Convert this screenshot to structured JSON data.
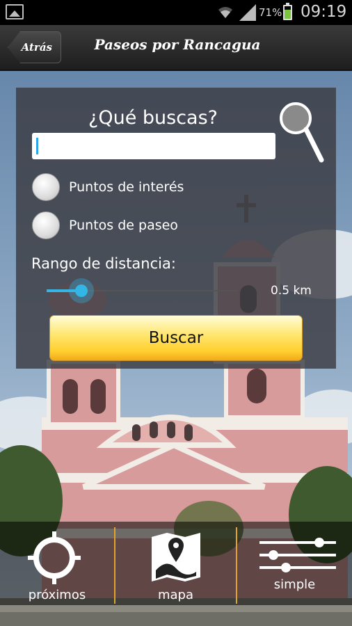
{
  "status_bar": {
    "battery_percent": "71%",
    "battery_level": 0.71,
    "time": "09:19",
    "icons": [
      "gallery-icon",
      "wifi-icon",
      "signal-icon",
      "battery-icon"
    ]
  },
  "action_bar": {
    "back_label": "Atrás",
    "title": "Paseos por Rancagua"
  },
  "search_panel": {
    "heading": "¿Qué buscas?",
    "search_value": "",
    "options": [
      {
        "label": "Puntos de interés",
        "selected": false
      },
      {
        "label": "Puntos de paseo",
        "selected": false
      }
    ],
    "range_label": "Rango de distancia:",
    "range_value_text": "0.5 km",
    "range_fraction": 0.18,
    "search_button_label": "Buscar"
  },
  "tab_bar": {
    "tabs": [
      {
        "label": "próximos",
        "icon": "crosshair-icon"
      },
      {
        "label": "mapa",
        "icon": "map-pin-icon"
      },
      {
        "label": "simple",
        "icon": "sliders-icon"
      }
    ]
  },
  "colors": {
    "accent_blue": "#33b5e5",
    "button_yellow": "#ffd43a",
    "divider_orange": "#e2a32a",
    "battery_green": "#7bc63d"
  }
}
